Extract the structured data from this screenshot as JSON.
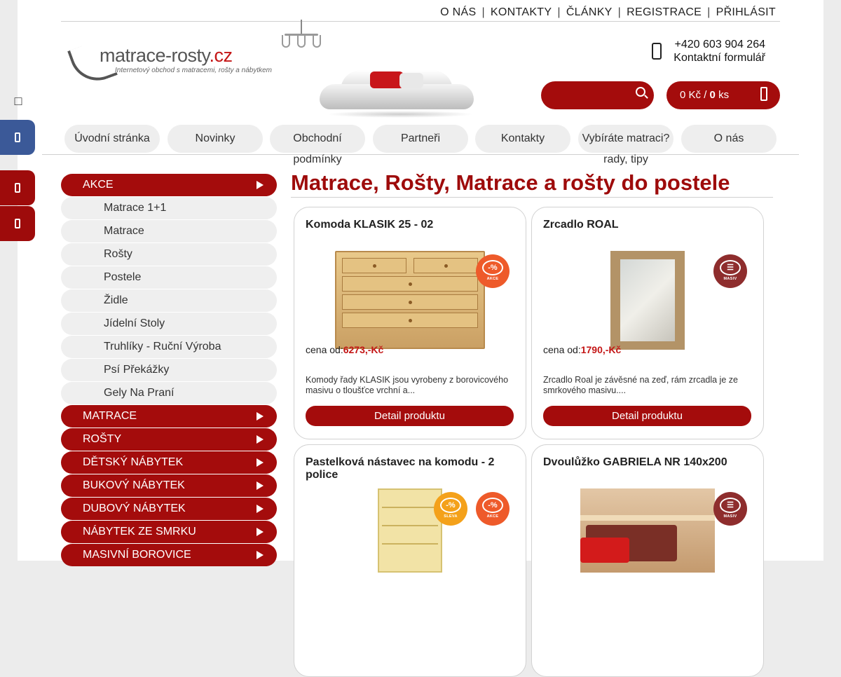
{
  "top_nav": {
    "items": [
      "O NÁS",
      "KONTAKTY",
      "ČLÁNKY",
      "REGISTRACE",
      "PŘIHLÁSIT"
    ],
    "separator": "|"
  },
  "logo": {
    "name_main": "matrace-rosty",
    "name_tld": ".cz",
    "tagline": "Internetový obchod s matracemi, rošty a nábytkem"
  },
  "contact": {
    "phone": "+420 603 904 264",
    "form_label": "Kontaktní formulář",
    "icon": "phone-icon"
  },
  "cart": {
    "amount": "0",
    "currency": "Kč",
    "separator": "/",
    "count": "0",
    "unit": "ks"
  },
  "main_nav": [
    {
      "label": "Úvodní stránka",
      "overflow": ""
    },
    {
      "label": "Novinky",
      "overflow": ""
    },
    {
      "label": "Obchodní",
      "overflow": "podmínky"
    },
    {
      "label": "Partneři",
      "overflow": ""
    },
    {
      "label": "Kontakty",
      "overflow": ""
    },
    {
      "label": "Vybíráte matraci?",
      "overflow": "rady, tipy"
    },
    {
      "label": "O nás",
      "overflow": ""
    }
  ],
  "sidebar": {
    "categories": [
      {
        "label": "AKCE",
        "type": "main"
      },
      {
        "label": "Matrace 1+1",
        "type": "sub"
      },
      {
        "label": "Matrace",
        "type": "sub"
      },
      {
        "label": "Rošty",
        "type": "sub"
      },
      {
        "label": "Postele",
        "type": "sub"
      },
      {
        "label": "Židle",
        "type": "sub"
      },
      {
        "label": "Jídelní Stoly",
        "type": "sub"
      },
      {
        "label": "Truhlíky - Ruční Výroba",
        "type": "sub"
      },
      {
        "label": "Psí Překážky",
        "type": "sub"
      },
      {
        "label": "Gely Na Praní",
        "type": "sub"
      },
      {
        "label": "MATRACE",
        "type": "main"
      },
      {
        "label": "ROŠTY",
        "type": "main"
      },
      {
        "label": "DĚTSKÝ NÁBYTEK",
        "type": "main"
      },
      {
        "label": "BUKOVÝ NÁBYTEK",
        "type": "main"
      },
      {
        "label": "DUBOVÝ NÁBYTEK",
        "type": "main"
      },
      {
        "label": "NÁBYTEK ZE SMRKU",
        "type": "main"
      },
      {
        "label": "MASIVNÍ BOROVICE",
        "type": "main"
      }
    ]
  },
  "content": {
    "heading": "Matrace, Rošty, Matrace a rošty do postele",
    "price_label": "cena od:",
    "detail_label": "Detail produktu",
    "products": [
      {
        "title": "Komoda KLASIK 25 - 02",
        "price": "6273,-Kč",
        "description": "Komody řady KLASIK jsou vyrobeny z borovicového masivu o tloušťce vrchní a...",
        "badges": [
          "akce"
        ]
      },
      {
        "title": "Zrcadlo ROAL",
        "price": "1790,-Kč",
        "description": "Zrcadlo Roal je závěsné na zeď, rám zrcadla je ze smrkového masivu....",
        "badges": [
          "masiv"
        ]
      },
      {
        "title": "Pastelková nástavec na komodu - 2 police",
        "price": "",
        "description": "",
        "badges": [
          "sleva",
          "akce"
        ]
      },
      {
        "title": "Dvoulůžko GABRIELA NR 140x200",
        "price": "",
        "description": "",
        "badges": [
          "masiv"
        ]
      }
    ],
    "badge_labels": {
      "akce": "AKCE",
      "sleva": "SLEVA",
      "masiv": "MASIV"
    },
    "badge_symbol": "-%"
  },
  "colors": {
    "brand_red": "#a40c0c",
    "heading_red": "#9e0b0b",
    "price_red": "#c41616",
    "facebook_blue": "#3b5998",
    "badge_akce": "#ee5a2a",
    "badge_sleva": "#f4a11a",
    "badge_masiv": "#8e2d2d"
  }
}
